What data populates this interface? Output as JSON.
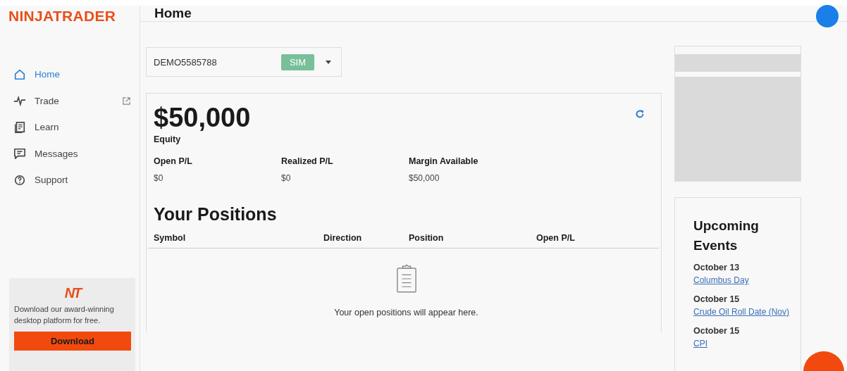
{
  "brand": {
    "logo": "NINJATRADER"
  },
  "header": {
    "title": "Home"
  },
  "sidebar": {
    "items": [
      {
        "label": "Home",
        "selected": true,
        "external": false
      },
      {
        "label": "Trade",
        "selected": false,
        "external": true
      },
      {
        "label": "Learn",
        "selected": false,
        "external": false
      },
      {
        "label": "Messages",
        "selected": false,
        "external": false
      },
      {
        "label": "Support",
        "selected": false,
        "external": false
      }
    ],
    "promo": {
      "logo": "NT",
      "text": "Download our award-winning desktop platform for free.",
      "button": "Download"
    }
  },
  "account": {
    "name": "DEMO5585788",
    "badge": "SIM"
  },
  "summary": {
    "equity": "$50,000",
    "equity_label": "Equity",
    "stats": [
      {
        "label": "Open P/L",
        "value": "$0"
      },
      {
        "label": "Realized P/L",
        "value": "$0"
      },
      {
        "label": "Margin Available",
        "value": "$50,000"
      }
    ]
  },
  "positions": {
    "title": "Your Positions",
    "columns": [
      "Symbol",
      "Direction",
      "Position",
      "Open P/L"
    ],
    "empty_text": "Your open positions will appear here."
  },
  "events": {
    "title": "Upcoming Events",
    "items": [
      {
        "date": "October 13",
        "name": "Columbus Day"
      },
      {
        "date": "October 15",
        "name": "Crude Oil Roll Date (Nov)"
      },
      {
        "date": "October 15",
        "name": "CPI"
      }
    ]
  }
}
